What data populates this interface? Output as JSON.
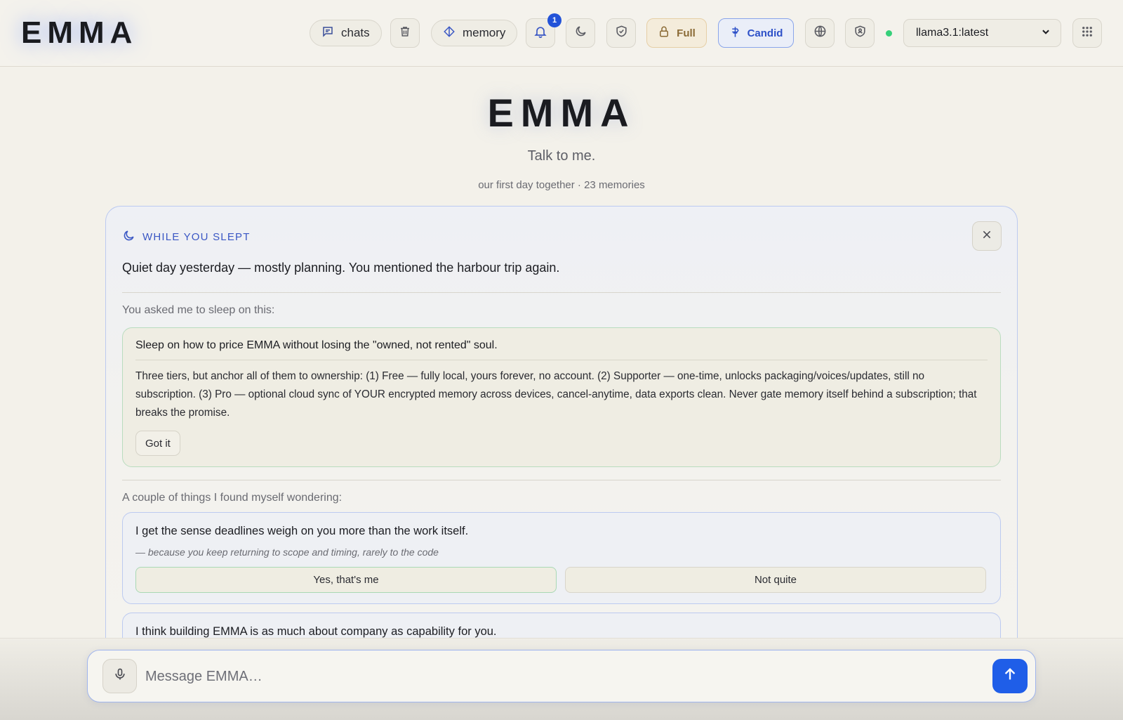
{
  "header": {
    "brand": "EMMA",
    "chats_label": "chats",
    "memory_label": "memory",
    "notification_count": "1",
    "full_label": "Full",
    "candid_label": "Candid",
    "model_selected": "llama3.1:latest",
    "status": "online",
    "accent_color": "#2353d8",
    "status_color": "#36d07a",
    "icons": [
      "chat-icon",
      "trash-icon",
      "diamond-icon",
      "bell-icon",
      "moon-icon",
      "shield-check-icon",
      "lock-icon",
      "candid-icon",
      "globe-icon",
      "shield-person-icon",
      "chevron-down-icon",
      "grid-icon"
    ]
  },
  "hero": {
    "title": "EMMA",
    "subtitle": "Talk to me.",
    "meta": "our first day together · 23 memories"
  },
  "card": {
    "heading": "WHILE YOU SLEPT",
    "summary": "Quiet day yesterday — mostly planning. You mentioned the harbour trip again.",
    "sleep_label": "You asked me to sleep on this:",
    "sleep_item": {
      "question": "Sleep on how to price EMMA without losing the \"owned, not rented\" soul.",
      "answer": "Three tiers, but anchor all of them to ownership: (1) Free — fully local, yours forever, no account. (2) Supporter — one-time, unlocks packaging/voices/updates, still no subscription. (3) Pro — optional cloud sync of YOUR encrypted memory across devices, cancel-anytime, data exports clean. Never gate memory itself behind a subscription; that breaks the promise.",
      "ack_label": "Got it"
    },
    "wonder_label": "A couple of things I found myself wondering:",
    "wonderings": [
      {
        "statement": "I get the sense deadlines weigh on you more than the work itself.",
        "reason": "— because you keep returning to scope and timing, rarely to the code",
        "yes_label": "Yes, that's me",
        "no_label": "Not quite"
      },
      {
        "statement": "I think building EMMA is as much about company as capability for you."
      }
    ]
  },
  "composer": {
    "placeholder": "Message EMMA…",
    "value": ""
  }
}
